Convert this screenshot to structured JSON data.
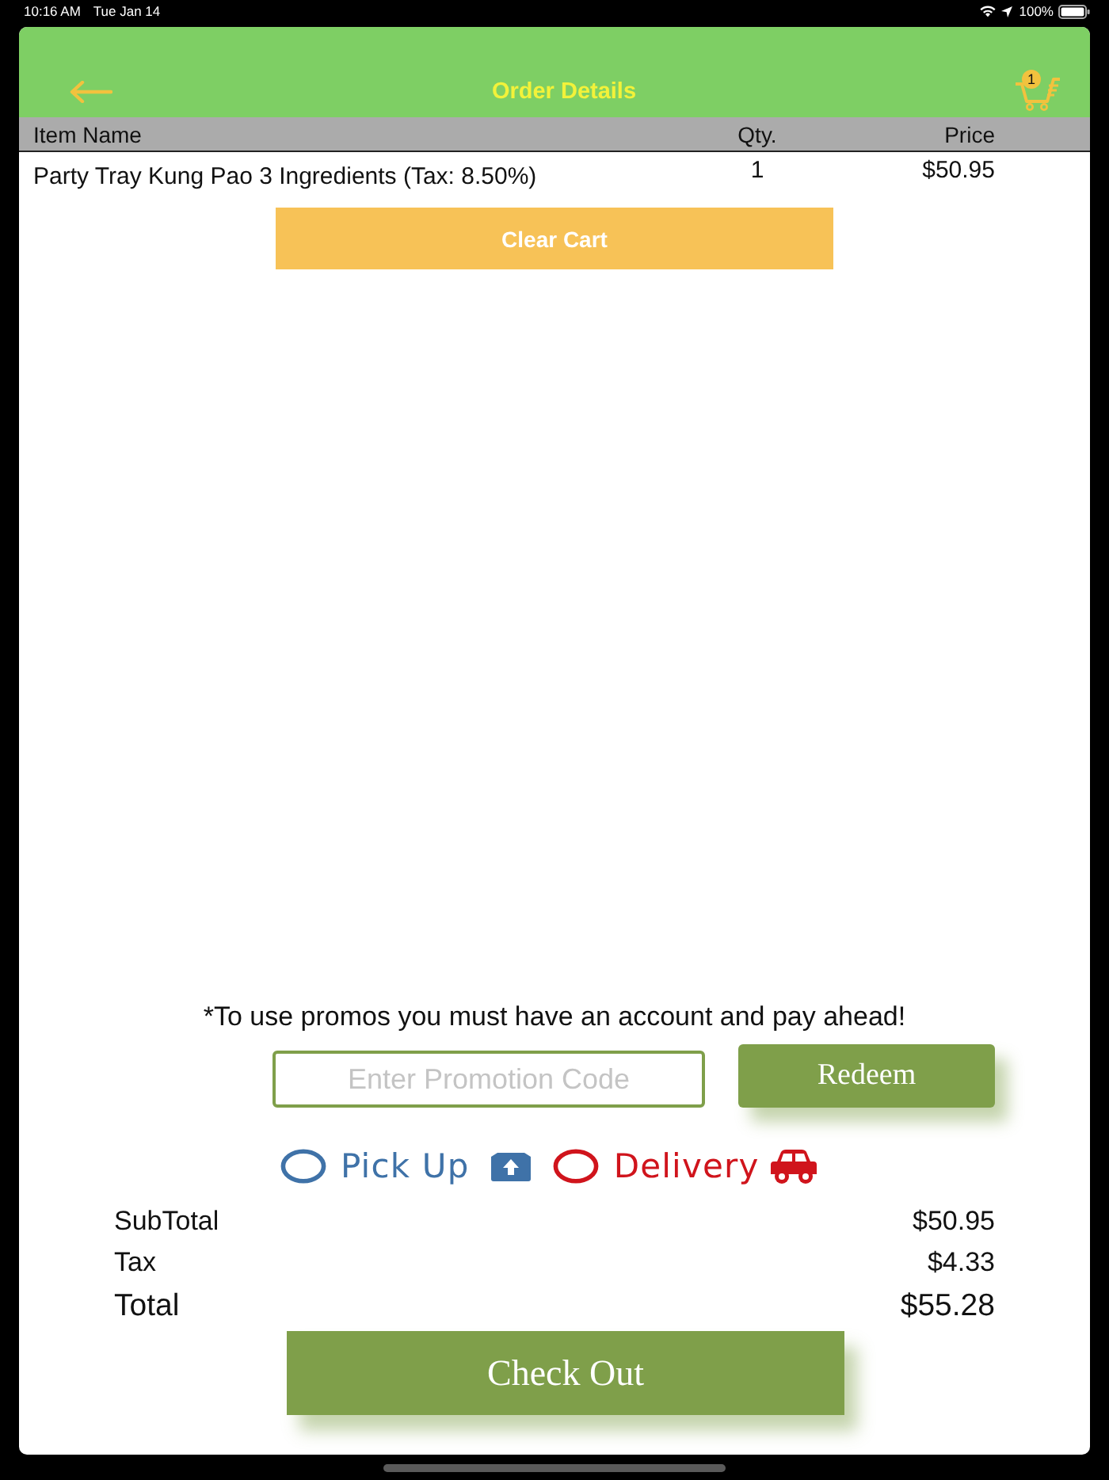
{
  "status_bar": {
    "time": "10:16 AM",
    "date": "Tue Jan 14",
    "battery": "100%"
  },
  "header": {
    "title": "Order Details",
    "cart_badge": "1"
  },
  "table": {
    "columns": [
      "Item Name",
      "Qty.",
      "Price"
    ],
    "rows": [
      {
        "item": "Party Tray Kung Pao 3 Ingredients (Tax: 8.50%)",
        "qty": "1",
        "price": "$50.95"
      }
    ]
  },
  "clear_button": "Clear Cart",
  "promo": {
    "note": "*To use promos you must have an account and pay ahead!",
    "placeholder": "Enter Promotion Code",
    "button": "Redeem"
  },
  "order_type": [
    {
      "label": "Pick Up",
      "kind": "pickup",
      "selected": false,
      "color": "#3f72a8"
    },
    {
      "label": "Delivery",
      "kind": "delivery",
      "selected": false,
      "color": "#d0141c"
    }
  ],
  "totals": [
    {
      "label": "SubTotal",
      "value": "$50.95",
      "kind": "line"
    },
    {
      "label": "Tax",
      "value": "$4.33",
      "kind": "line"
    },
    {
      "label": "Total",
      "value": "$55.28",
      "kind": "grand"
    }
  ],
  "checkout_button": "Check Out"
}
